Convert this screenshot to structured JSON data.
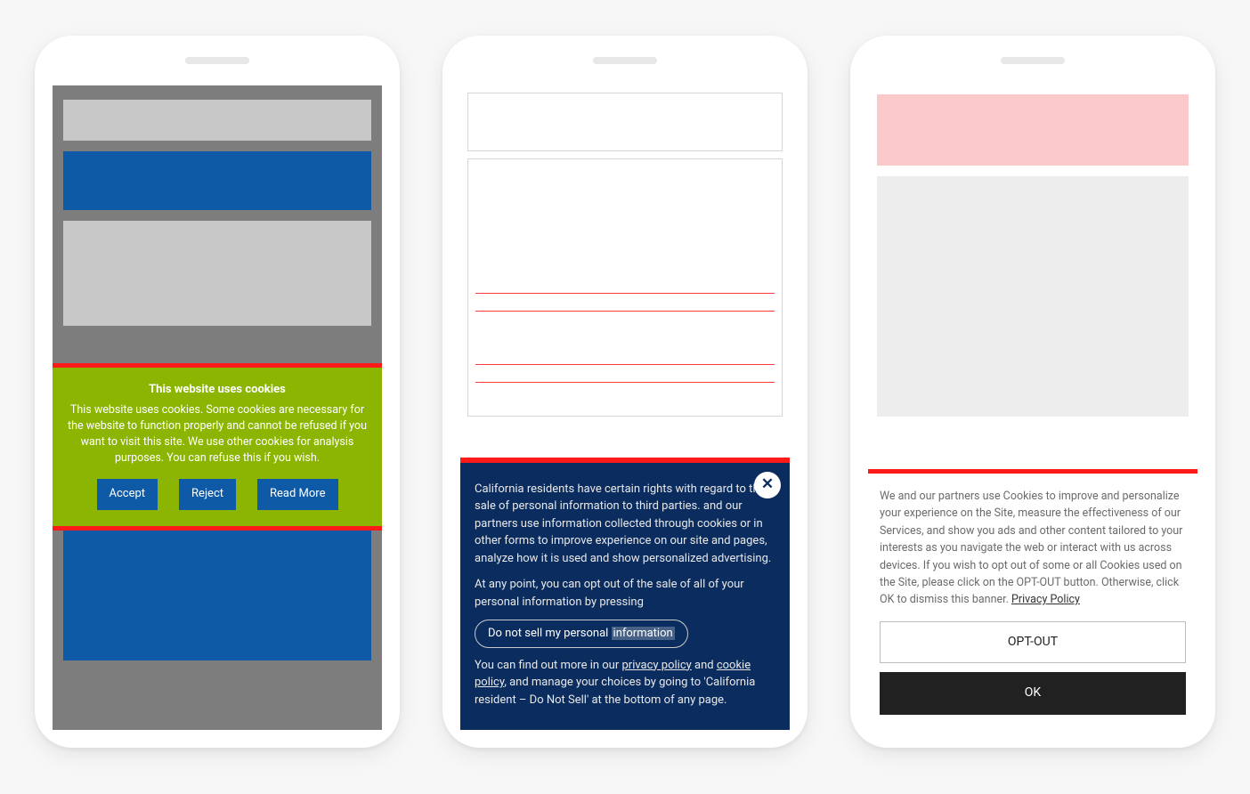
{
  "phone1": {
    "banner": {
      "title": "This website uses cookies",
      "body": "This website uses cookies. Some cookies are necessary for the website to function properly and cannot be refused if you want to visit this site. We use other cookies for analysis purposes. You can refuse this if you wish.",
      "accept": "Accept",
      "reject": "Reject",
      "readmore": "Read More"
    }
  },
  "phone2": {
    "banner": {
      "p1_a": "California residents have certain rights with regard to the sale of personal information to third parties. ",
      "p1_b": " and our partners use information collected through cookies or in other forms to improve experience on our site and pages, analyze how it is used and show personalized advertising.",
      "p2": "At any point, you can opt out of the sale of all of your personal information by pressing",
      "dns_a": "Do not sell my personal ",
      "dns_b": "information",
      "p3_a": "You can find out more in our ",
      "link_priv": "privacy policy",
      "p3_and": " and ",
      "link_cookie": "cookie policy",
      "p3_b": ", and manage your choices by going to 'California resident – Do Not Sell' at the bottom of any page.",
      "close": "✕"
    }
  },
  "phone3": {
    "banner": {
      "body": "We and our partners use Cookies to improve and personalize your experience on the Site, measure the effectiveness of our Services, and show you ads and other content tailored to your interests as you navigate the web or interact with us across devices. If you wish to opt out of some or all Cookies used on the Site, please click on the OPT-OUT button. Otherwise, click OK to dismiss this banner. ",
      "privacy": "Privacy Policy",
      "optout": "OPT-OUT",
      "ok": "OK"
    }
  }
}
